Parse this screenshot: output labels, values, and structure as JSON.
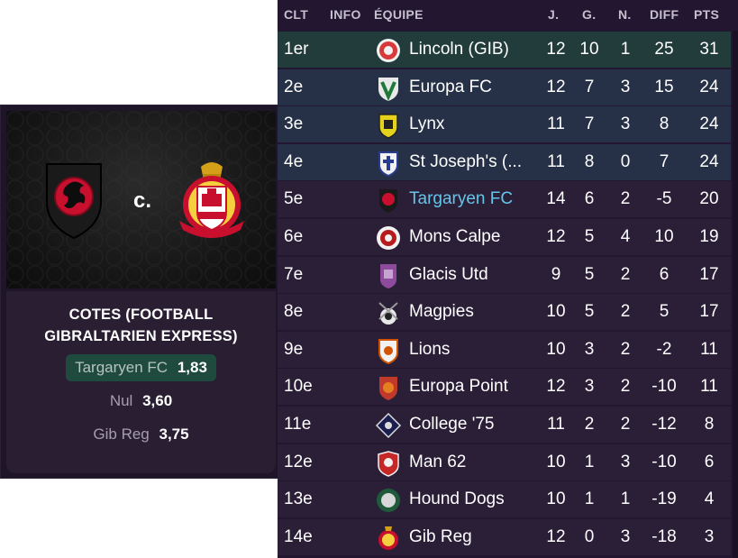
{
  "match": {
    "vs_label": "c.",
    "home_crest_icon": "dragon-crest-icon",
    "away_crest_icon": "gibraltar-crest-icon",
    "odds_title_line1": "COTES (FOOTBALL",
    "odds_title_line2": "GIBRALTARIEN EXPRESS)",
    "odds": [
      {
        "label": "Targaryen FC",
        "value": "1,83"
      },
      {
        "label": "Nul",
        "value": "3,60"
      },
      {
        "label": "Gib Reg",
        "value": "3,75"
      }
    ]
  },
  "table": {
    "headers": {
      "clt": "CLT",
      "info": "INFO",
      "team": "ÉQUIPE",
      "j": "J.",
      "g": "G.",
      "n": "N.",
      "diff": "DIFF",
      "pts": "PTS"
    },
    "colors": {
      "promo": "#213c3b",
      "playoff": "#263147",
      "default": "#2b1f38",
      "own_team_text": "#63c6e9"
    },
    "rows": [
      {
        "pos": "1er",
        "team": "Lincoln (GIB)",
        "j": "12",
        "g": "10",
        "n": "1",
        "diff": "25",
        "pts": "31",
        "icon": "lincoln-crest-icon"
      },
      {
        "pos": "2e",
        "team": "Europa FC",
        "j": "12",
        "g": "7",
        "n": "3",
        "diff": "15",
        "pts": "24",
        "icon": "europa-crest-icon"
      },
      {
        "pos": "3e",
        "team": "Lynx",
        "j": "11",
        "g": "7",
        "n": "3",
        "diff": "8",
        "pts": "24",
        "icon": "lynx-crest-icon"
      },
      {
        "pos": "4e",
        "team": "St Joseph's (...",
        "j": "11",
        "g": "8",
        "n": "0",
        "diff": "7",
        "pts": "24",
        "icon": "st-josephs-crest-icon"
      },
      {
        "pos": "5e",
        "team": "Targaryen FC",
        "j": "14",
        "g": "6",
        "n": "2",
        "diff": "-5",
        "pts": "20",
        "icon": "targaryen-crest-icon"
      },
      {
        "pos": "6e",
        "team": "Mons Calpe",
        "j": "12",
        "g": "5",
        "n": "4",
        "diff": "10",
        "pts": "19",
        "icon": "mons-calpe-crest-icon"
      },
      {
        "pos": "7e",
        "team": "Glacis Utd",
        "j": "9",
        "g": "5",
        "n": "2",
        "diff": "6",
        "pts": "17",
        "icon": "glacis-crest-icon"
      },
      {
        "pos": "8e",
        "team": "Magpies",
        "j": "10",
        "g": "5",
        "n": "2",
        "diff": "5",
        "pts": "17",
        "icon": "magpies-crest-icon"
      },
      {
        "pos": "9e",
        "team": "Lions",
        "j": "10",
        "g": "3",
        "n": "2",
        "diff": "-2",
        "pts": "11",
        "icon": "lions-crest-icon"
      },
      {
        "pos": "10e",
        "team": "Europa Point",
        "j": "12",
        "g": "3",
        "n": "2",
        "diff": "-10",
        "pts": "11",
        "icon": "europa-point-crest-icon"
      },
      {
        "pos": "11e",
        "team": "College '75",
        "j": "11",
        "g": "2",
        "n": "2",
        "diff": "-12",
        "pts": "8",
        "icon": "college-crest-icon"
      },
      {
        "pos": "12e",
        "team": "Man 62",
        "j": "10",
        "g": "1",
        "n": "3",
        "diff": "-10",
        "pts": "6",
        "icon": "man62-crest-icon"
      },
      {
        "pos": "13e",
        "team": "Hound Dogs",
        "j": "10",
        "g": "1",
        "n": "1",
        "diff": "-19",
        "pts": "4",
        "icon": "hound-dogs-crest-icon"
      },
      {
        "pos": "14e",
        "team": "Gib Reg",
        "j": "12",
        "g": "0",
        "n": "3",
        "diff": "-18",
        "pts": "3",
        "icon": "gib-reg-crest-icon"
      }
    ]
  }
}
